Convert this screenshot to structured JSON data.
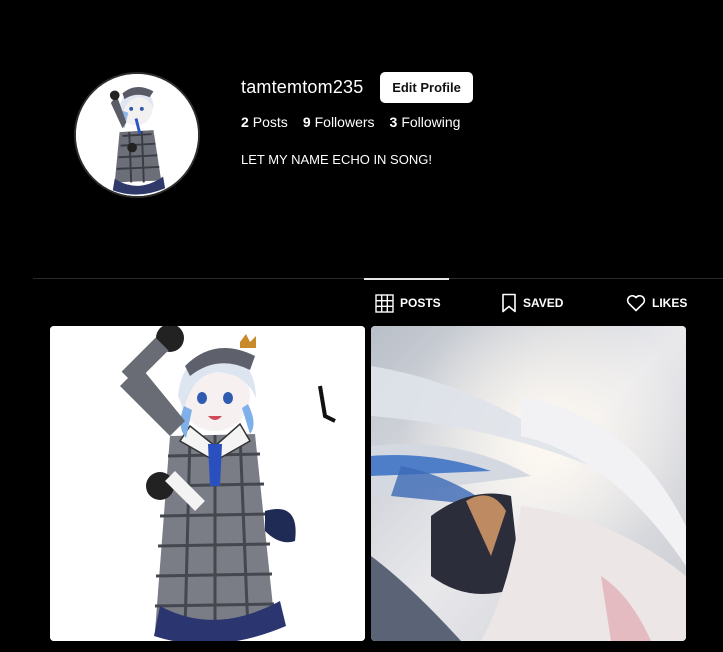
{
  "profile": {
    "username": "tamtemtom235",
    "edit_label": "Edit Profile",
    "posts_count": "2",
    "posts_label": "Posts",
    "followers_count": "9",
    "followers_label": "Followers",
    "following_count": "3",
    "following_label": "Following",
    "bio": "LET MY NAME ECHO IN SONG!"
  },
  "tabs": [
    {
      "label": "POSTS",
      "icon": "grid-icon",
      "active": true
    },
    {
      "label": "SAVED",
      "icon": "bookmark-icon",
      "active": false
    },
    {
      "label": "LIKES",
      "icon": "heart-icon",
      "active": false
    }
  ],
  "colors": {
    "background": "#000000",
    "button_bg": "#ffffff",
    "divider": "#2b2b2b"
  }
}
